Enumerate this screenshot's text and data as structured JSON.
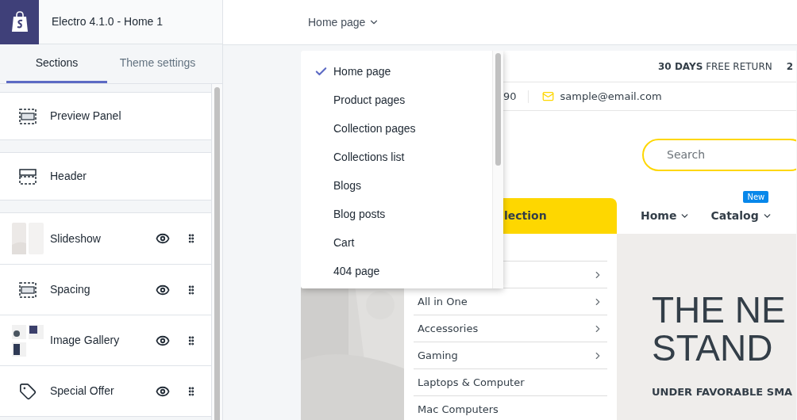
{
  "app": {
    "title": "Electro 4.1.0 - Home 1"
  },
  "tabs": [
    {
      "label": "Sections",
      "selected": true
    },
    {
      "label": "Theme settings",
      "selected": false
    }
  ],
  "section_groups": [
    [
      {
        "kind": "layout",
        "label": "Preview Panel"
      }
    ],
    [
      {
        "kind": "header",
        "label": "Header"
      }
    ],
    [
      {
        "kind": "thumbnail",
        "label": "Slideshow",
        "visible": true
      },
      {
        "kind": "layout",
        "label": "Spacing",
        "visible": true
      },
      {
        "kind": "gallery",
        "label": "Image Gallery",
        "visible": true
      },
      {
        "kind": "tag",
        "label": "Special Offer",
        "visible": true
      }
    ]
  ],
  "page_picker": {
    "label": "Home page",
    "expanded": true,
    "options": [
      {
        "label": "Home page",
        "selected": true
      },
      {
        "label": "Product pages",
        "selected": false
      },
      {
        "label": "Collection pages",
        "selected": false
      },
      {
        "label": "Collections list",
        "selected": false
      },
      {
        "label": "Blogs",
        "selected": false
      },
      {
        "label": "Blog posts",
        "selected": false
      },
      {
        "label": "Cart",
        "selected": false
      },
      {
        "label": "404 page",
        "selected": false
      }
    ]
  },
  "preview": {
    "topbar": [
      "**30 DAYS** FREE RETURN",
      "2"
    ],
    "phone": "90",
    "email": "sample@email.com",
    "search": {
      "placeholder": "Search"
    },
    "category_tab": "lection",
    "nav": [
      {
        "label": "Home"
      },
      {
        "label": "Catalog",
        "badge": "New"
      }
    ],
    "categories": [
      {
        "arrow": false
      },
      {
        "arrow": true
      },
      {
        "label": "All in One",
        "arrow": true
      },
      {
        "label": "Accessories",
        "arrow": true
      },
      {
        "label": "Gaming",
        "arrow": true
      },
      {
        "label": "Laptops & Computer",
        "arrow": false
      },
      {
        "label": "Mac Computers",
        "arrow": false
      }
    ],
    "hero": {
      "title_lines": [
        "THE NE",
        "STAND"
      ],
      "subtitle": "UNDER FAVORABLE SMA"
    }
  }
}
